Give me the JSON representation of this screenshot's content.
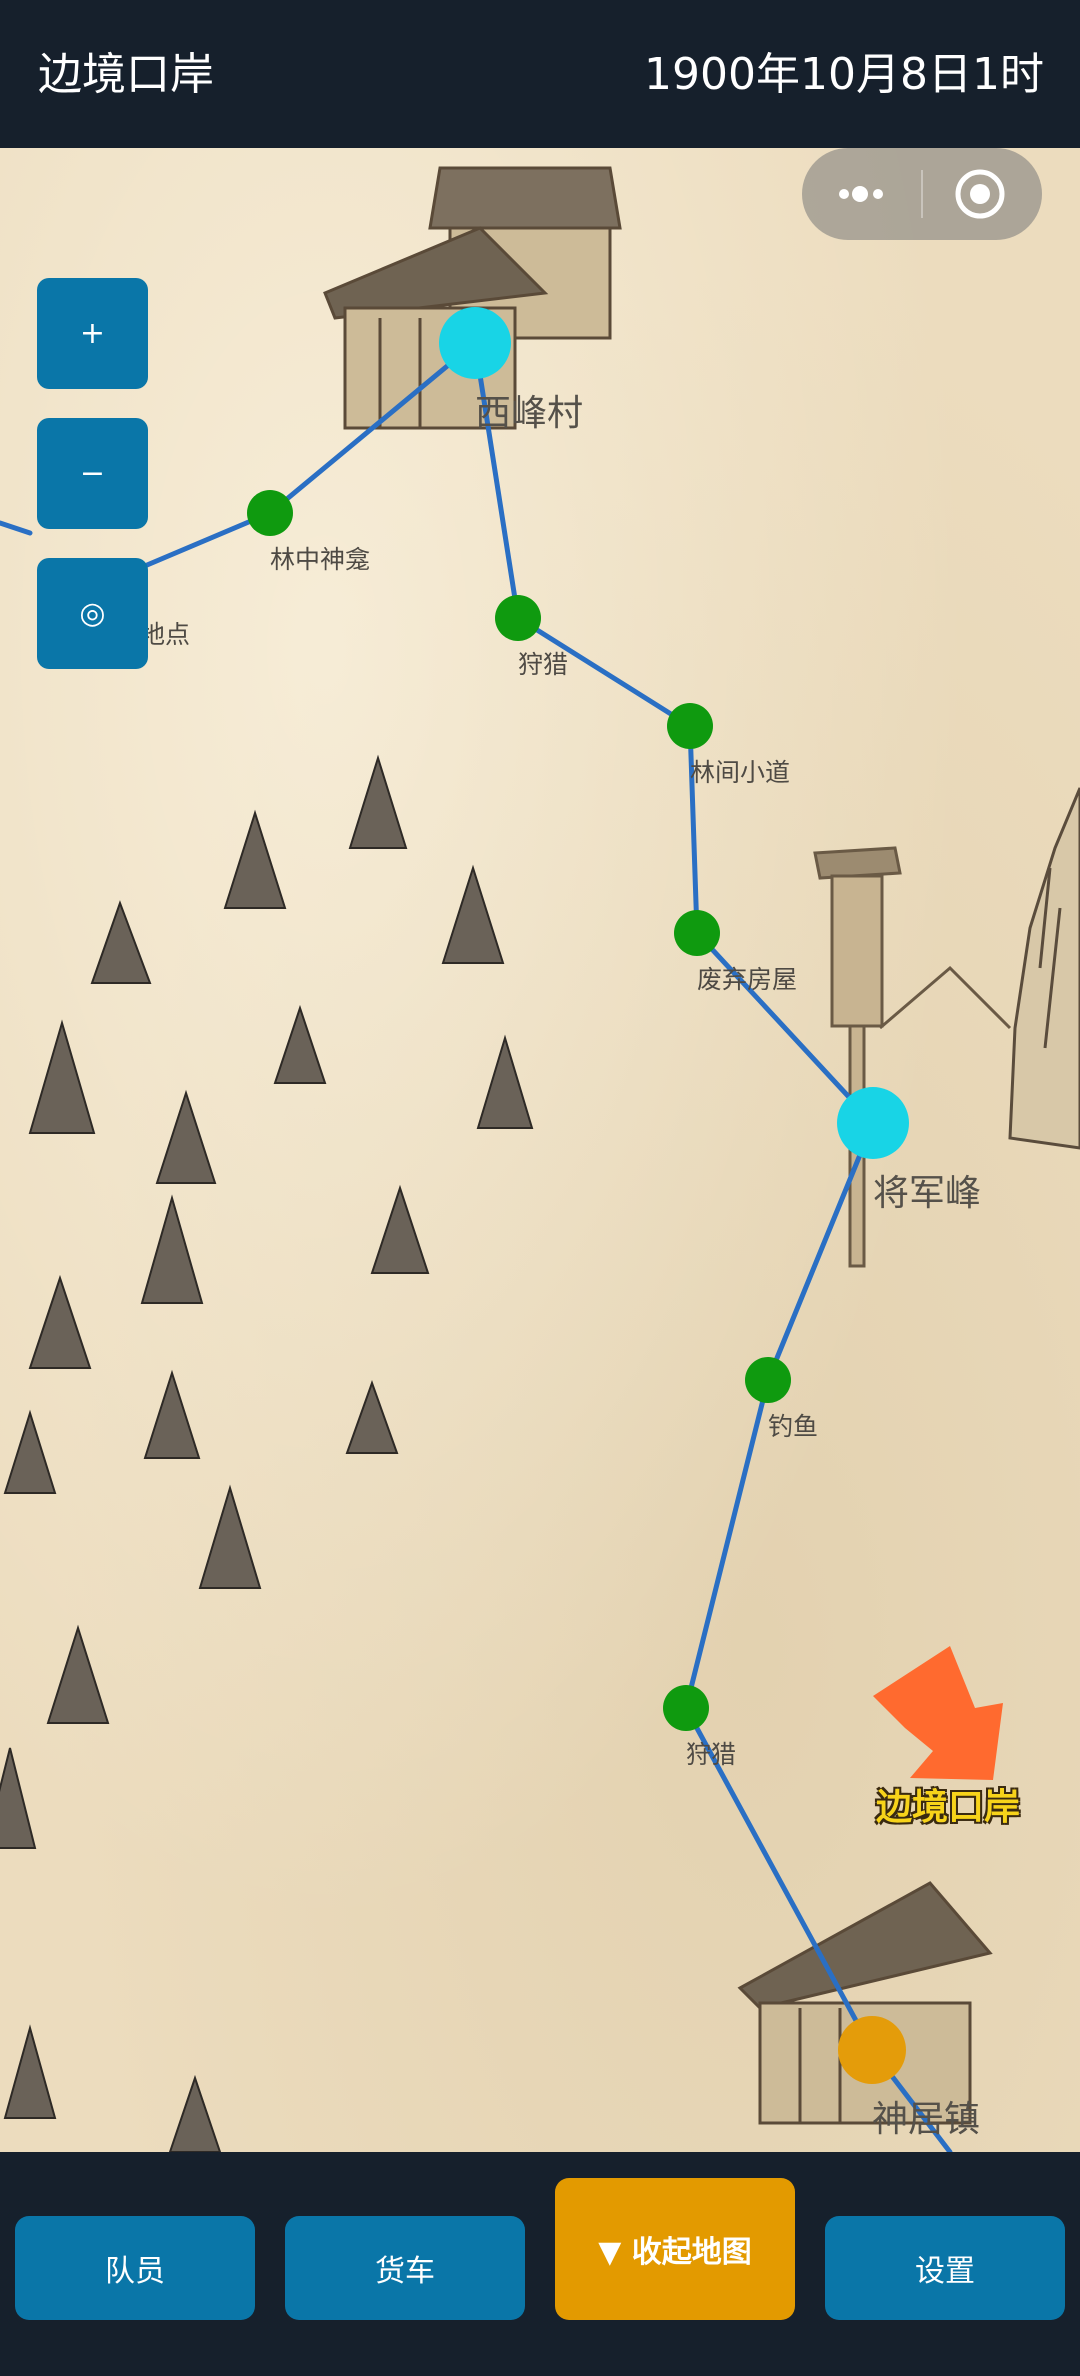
{
  "header": {
    "title": "边境口岸",
    "datetime": "1900年10月8日1时"
  },
  "zoom": {
    "zoom_in": "+",
    "zoom_out": "−",
    "locate": "◎"
  },
  "capsule": {
    "more": "•••",
    "close": "◉"
  },
  "map": {
    "locations": [
      {
        "name": "西峰村"
      },
      {
        "name": "将军峰"
      },
      {
        "name": "神居镇"
      }
    ],
    "pois": [
      {
        "name": "林中神龛"
      },
      {
        "name": "地点"
      },
      {
        "name": "狩猎"
      },
      {
        "name": "林间小道"
      },
      {
        "name": "废弃房屋"
      },
      {
        "name": "钓鱼"
      },
      {
        "name": "狩猎"
      }
    ],
    "destination": "边境口岸",
    "colors": {
      "route": "#2a6fc4",
      "location_node": "#18d4e6",
      "poi_node": "#0f9a0f",
      "current_node": "#e49c0a",
      "arrow": "#ff6a2f",
      "destination_text": "#f7d31a"
    }
  },
  "bottom_nav": {
    "members": "队员",
    "wagon": "货车",
    "collapse_map": "▼ 收起地图",
    "settings": "设置"
  }
}
